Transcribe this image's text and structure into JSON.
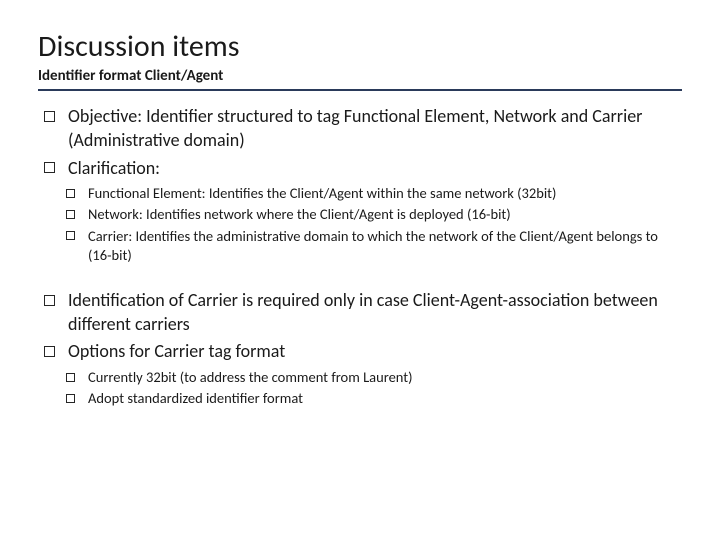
{
  "title": "Discussion items",
  "subtitle": "Identifier format Client/Agent",
  "items_a": [
    {
      "text": "Objective: Identifier structured to tag Functional Element, Network and Carrier (Administrative domain)",
      "children": []
    },
    {
      "text": "Clarification:",
      "children": [
        "Functional Element: Identifies the Client/Agent within the same network (32bit)",
        "Network: Identifies network where the Client/Agent is deployed (16-bit)",
        "Carrier: Identifies the administrative domain to which the network of the Client/Agent belongs to (16-bit)"
      ]
    }
  ],
  "items_b": [
    {
      "text": "Identification of Carrier is required only in case Client-Agent-association between different carriers",
      "children": []
    },
    {
      "text": "Options for Carrier tag format",
      "children": [
        "Currently 32bit (to address the comment from Laurent)",
        "Adopt standardized identifier format"
      ]
    }
  ]
}
